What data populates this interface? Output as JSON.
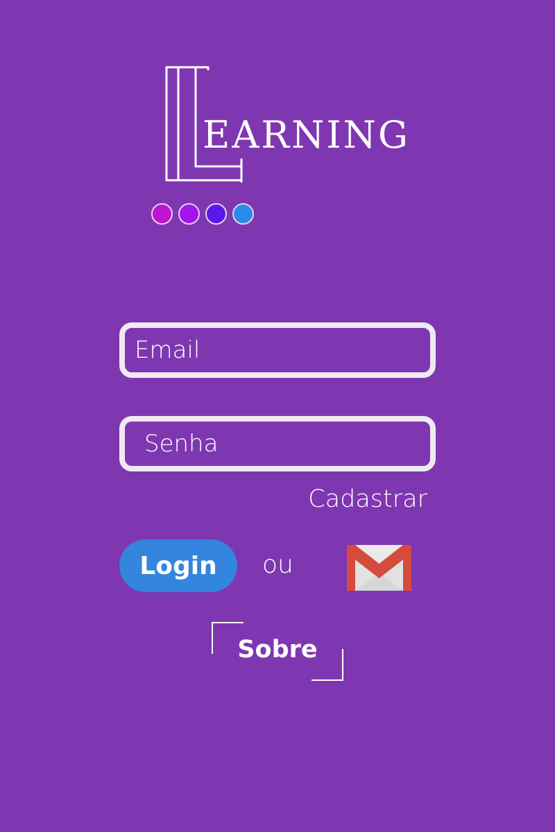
{
  "logo": {
    "word": "EARNING",
    "dot_colors": [
      "#c014d4",
      "#a114ec",
      "#5a19ea",
      "#2a8ce8"
    ]
  },
  "form": {
    "email_placeholder": "Email",
    "password_placeholder": "Senha",
    "register_link": "Cadastrar"
  },
  "actions": {
    "login_label": "Login",
    "or_text": "ou",
    "gmail_icon": "gmail-icon",
    "about_label": "Sobre"
  },
  "colors": {
    "background": "#7f37b1",
    "login_button": "#3485de",
    "field_border": "#efeaf2"
  }
}
